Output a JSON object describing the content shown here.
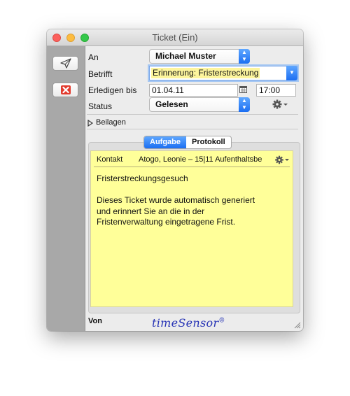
{
  "window": {
    "title": "Ticket (Ein)"
  },
  "form": {
    "an_label": "An",
    "an_value": "Michael Muster",
    "betrifft_label": "Betrifft",
    "betrifft_value": "Erinnerung: Fristerstreckung",
    "erledigen_label": "Erledigen bis",
    "date_value": "01.04.11",
    "time_value": "17:00",
    "status_label": "Status",
    "status_value": "Gelesen"
  },
  "beilagen": {
    "label": "Beilagen"
  },
  "tabs": [
    {
      "label": "Aufgabe",
      "active": true
    },
    {
      "label": "Protokoll",
      "active": false
    }
  ],
  "note": {
    "kontakt_label": "Kontakt",
    "kontakt_value": "Atogo, Leonie – 15|11 Aufenthaltsbe",
    "body": "Fristerstreckungsgesuch\n\nDieses Ticket wurde automatisch generiert\nund erinnert Sie an die in der\nFristenverwaltung eingetragene Frist.",
    "background": "#ffff99"
  },
  "footer": {
    "von_label": "Von",
    "logo_text": "timeSensor",
    "logo_mark": "®"
  },
  "colors": {
    "accent": "#1b6ef2",
    "highlight": "#fdf59d",
    "logo": "#2633b5"
  }
}
